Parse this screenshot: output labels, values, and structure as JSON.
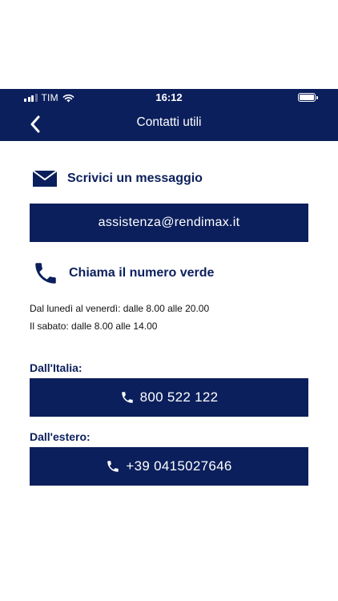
{
  "status_bar": {
    "carrier": "TIM",
    "time": "16:12"
  },
  "header": {
    "title": "Contatti utili"
  },
  "email_section": {
    "icon": "envelope-icon",
    "title": "Scrivici un messaggio",
    "email": "assistenza@rendimax.it"
  },
  "phone_section": {
    "icon": "phone-icon",
    "title": "Chiama il numero verde",
    "hours": [
      "Dal lunedì al venerdì: dalle 8.00 alle 20.00",
      "Il sabato: dalle 8.00 alle 14.00"
    ],
    "italy": {
      "label": "Dall'Italia:",
      "number": "800 522 122"
    },
    "abroad": {
      "label": "Dall'estero:",
      "number": "+39 0415027646"
    }
  },
  "colors": {
    "brand": "#0b1f5c",
    "background": "#ffffff",
    "text": "#111111"
  }
}
